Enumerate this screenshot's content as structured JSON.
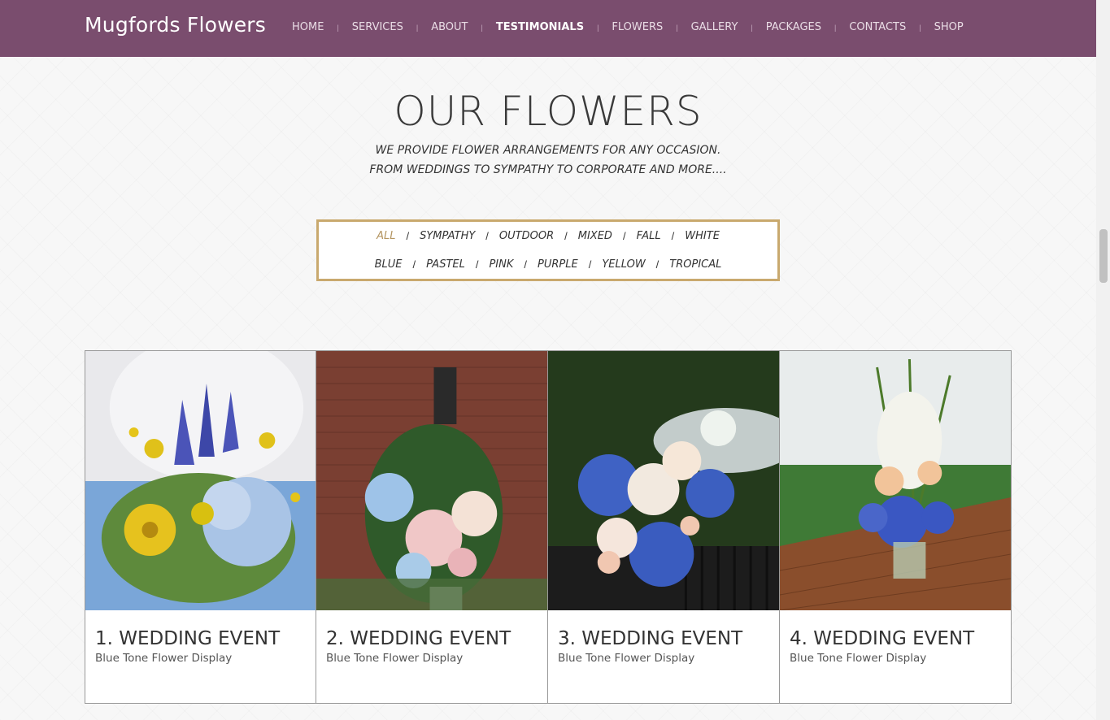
{
  "header": {
    "brand": "Mugfords Flowers",
    "nav": [
      "HOME",
      "SERVICES",
      "ABOUT",
      "TESTIMONIALS",
      "FLOWERS",
      "GALLERY",
      "PACKAGES",
      "CONTACTS",
      "SHOP"
    ],
    "active_nav": "TESTIMONIALS"
  },
  "section": {
    "title": "OUR FLOWERS",
    "subtitle_line1": "WE PROVIDE FLOWER ARRANGEMENTS FOR ANY OCCASION.",
    "subtitle_line2": "FROM WEDDINGS TO SYMPATHY TO CORPORATE AND MORE...."
  },
  "filters": {
    "row1": [
      "ALL",
      "SYMPATHY",
      "OUTDOOR",
      "MIXED",
      "FALL",
      "WHITE"
    ],
    "row2": [
      "BLUE",
      "PASTEL",
      "PINK",
      "PURPLE",
      "YELLOW",
      "TROPICAL"
    ],
    "active": "ALL",
    "separator": "/"
  },
  "gallery": [
    {
      "title": "1. WEDDING EVENT",
      "desc": "Blue Tone Flower Display"
    },
    {
      "title": "2. WEDDING EVENT",
      "desc": "Blue Tone Flower Display"
    },
    {
      "title": "3. WEDDING EVENT",
      "desc": "Blue Tone Flower Display"
    },
    {
      "title": "4. WEDDING EVENT",
      "desc": "Blue Tone Flower Display"
    }
  ],
  "colors": {
    "header_bg": "#7a4d6e",
    "accent_gold": "#c9a96e"
  }
}
